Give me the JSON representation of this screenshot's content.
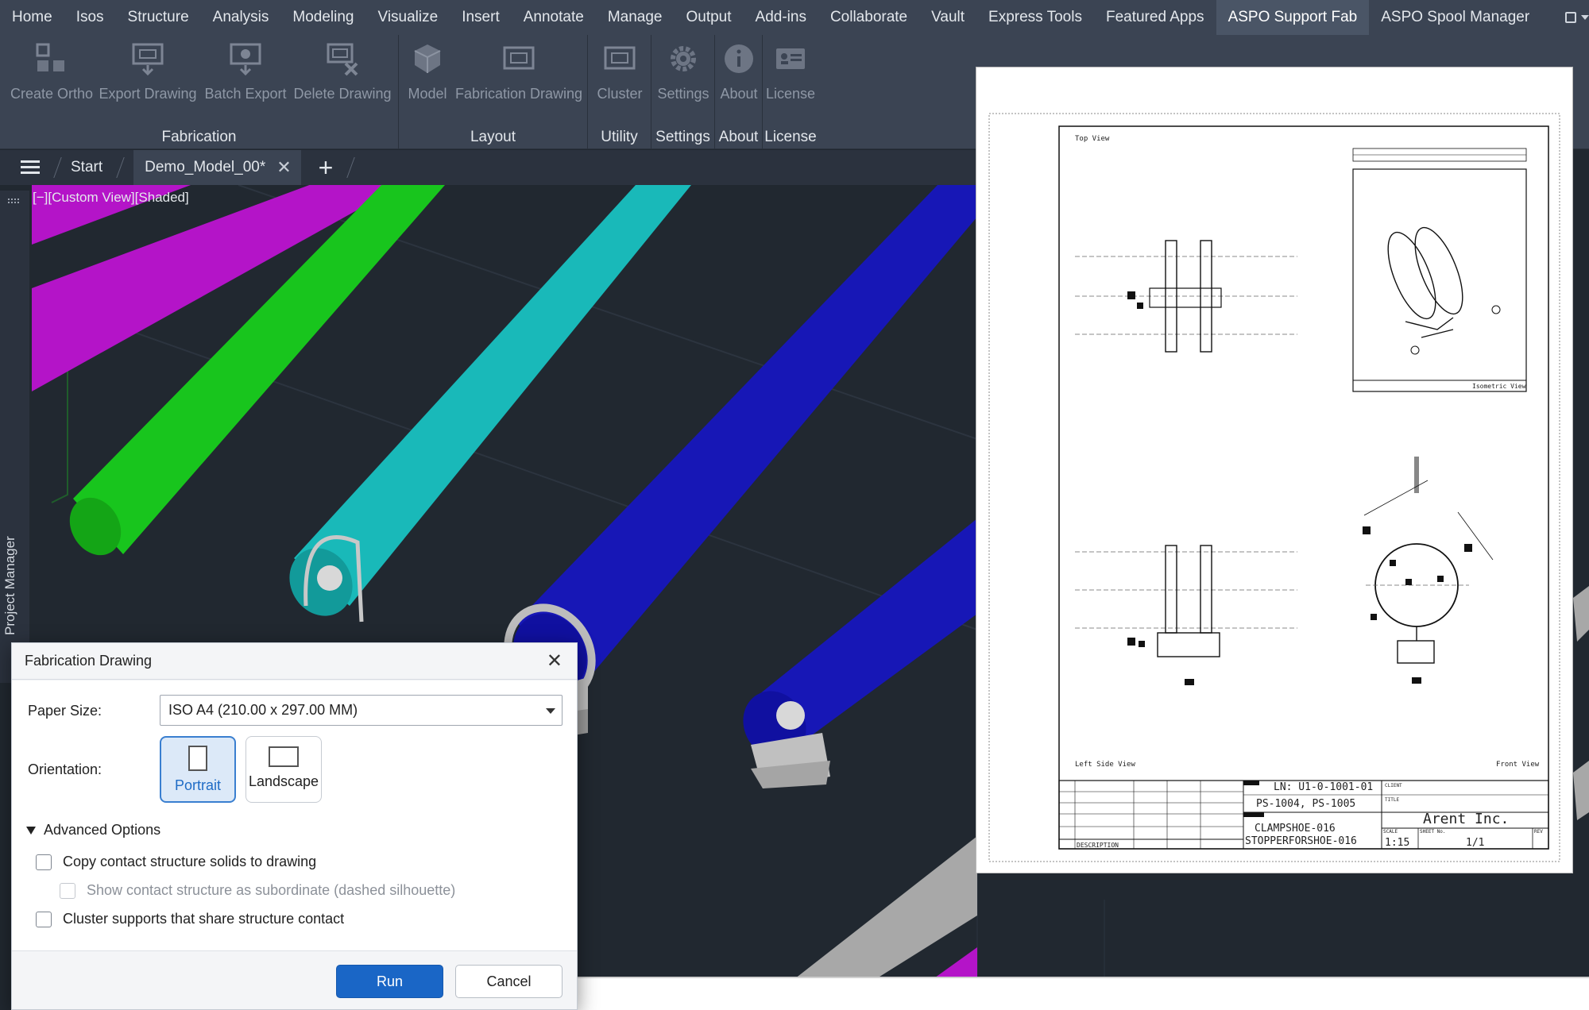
{
  "menubar": {
    "items": [
      "Home",
      "Isos",
      "Structure",
      "Analysis",
      "Modeling",
      "Visualize",
      "Insert",
      "Annotate",
      "Manage",
      "Output",
      "Add-ins",
      "Collaborate",
      "Vault",
      "Express Tools",
      "Featured Apps",
      "ASPO Support Fab",
      "ASPO Spool Manager"
    ],
    "active": "ASPO Support Fab"
  },
  "ribbon": {
    "panels": {
      "fabrication": {
        "title": "Fabrication",
        "buttons": [
          "Create Ortho",
          "Export Drawing",
          "Batch Export",
          "Delete Drawing"
        ]
      },
      "layout": {
        "title": "Layout",
        "buttons": [
          "Model",
          "Fabrication Drawing"
        ]
      },
      "utility": {
        "title": "Utility",
        "buttons": [
          "Cluster"
        ]
      },
      "settings": {
        "title": "Settings",
        "buttons": [
          "Settings"
        ]
      },
      "about": {
        "title": "About",
        "buttons": [
          "About"
        ]
      },
      "license": {
        "title": "License",
        "buttons": [
          "License"
        ]
      }
    }
  },
  "tabs": {
    "start": "Start",
    "active": "Demo_Model_00*"
  },
  "viewport": {
    "view_label": "[−][Custom View][Shaded]",
    "side_panel": "Project Manager"
  },
  "preview": {
    "top_view": "Top View",
    "iso_view": "Isometric View",
    "left_view": "Left Side View",
    "front_view": "Front View",
    "line_no": "LN: U1-0-1001-01",
    "supports": "PS-1004, PS-1005",
    "part1": "CLAMPSHOE-016",
    "part2": "STOPPERFORSHOE-016",
    "company": "Arent Inc.",
    "scale": "1:15",
    "sheet": "1/1",
    "description": "DESCRIPTION",
    "client_label": "CLIENT",
    "title_label": "TITLE",
    "scale_label": "SCALE",
    "sheet_label": "SHEET No.",
    "rev_label": "REV"
  },
  "dialog": {
    "title": "Fabrication Drawing",
    "paper_size_label": "Paper Size:",
    "paper_size_value": "ISO A4 (210.00 x 297.00 MM)",
    "orientation_label": "Orientation:",
    "orientation_options": [
      "Portrait",
      "Landscape"
    ],
    "orientation_selected": "Portrait",
    "advanced_label": "Advanced Options",
    "options": [
      {
        "label": "Copy contact structure solids to drawing",
        "checked": false,
        "enabled": true
      },
      {
        "label": "Show contact structure as subordinate (dashed silhouette)",
        "checked": false,
        "enabled": false
      },
      {
        "label": "Cluster supports that share structure contact",
        "checked": false,
        "enabled": true
      }
    ],
    "run_label": "Run",
    "cancel_label": "Cancel"
  },
  "colors": {
    "ribbon_bg": "#3b4453",
    "viewport_bg": "#212830",
    "pipe_magenta": "#b414c8",
    "pipe_green": "#14c814",
    "pipe_cyan": "#14b4b4",
    "pipe_blue": "#1414b4",
    "pipe_gray": "#aaaaaa",
    "accent_blue": "#1a66c6"
  }
}
